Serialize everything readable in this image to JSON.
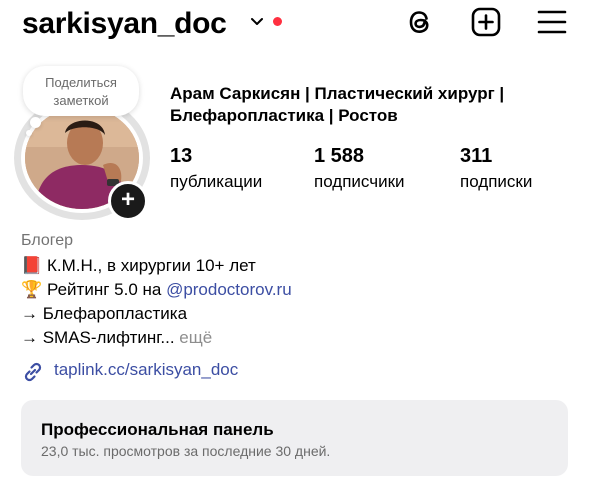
{
  "header": {
    "username": "sarkisyan_doc",
    "notification_color": "#ff3040",
    "icons": [
      "chevron-down-icon",
      "threads-icon",
      "create-icon",
      "menu-icon"
    ]
  },
  "note": {
    "text": "Поделиться заметкой"
  },
  "profile": {
    "full_name": "Арам Саркисян | Пластический хирург | Блефаропластика | Ростов",
    "add_story_symbol": "+"
  },
  "stats": [
    {
      "value": "13",
      "label": "публикации"
    },
    {
      "value": "1 588",
      "label": "подписчики"
    },
    {
      "value": "311",
      "label": "подписки"
    }
  ],
  "bio": {
    "category": "Блогер",
    "lines": [
      {
        "emoji": "📕",
        "text": "К.М.Н., в хирургии 10+ лет"
      },
      {
        "emoji": "🏆",
        "text": "Рейтинг 5.0 на ",
        "mention": "@prodoctorov.ru"
      },
      {
        "text": "→ Блефаропластика"
      },
      {
        "text": "→ SMAS-лифтинг...",
        "more": " ещё"
      }
    ]
  },
  "link": {
    "text": "taplink.cc/sarkisyan_doc",
    "color": "#3c4ea3"
  },
  "pro_panel": {
    "title": "Профессиональная панель",
    "subtitle": "23,0 тыс. просмотров за последние 30 дней."
  }
}
